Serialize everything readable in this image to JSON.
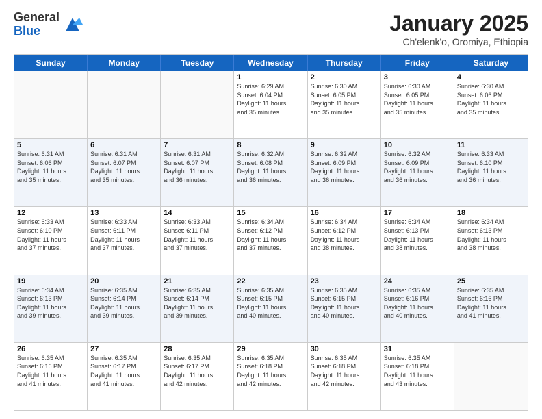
{
  "header": {
    "logo_general": "General",
    "logo_blue": "Blue",
    "month_title": "January 2025",
    "subtitle": "Ch'elenk'o, Oromiya, Ethiopia"
  },
  "day_headers": [
    "Sunday",
    "Monday",
    "Tuesday",
    "Wednesday",
    "Thursday",
    "Friday",
    "Saturday"
  ],
  "weeks": [
    [
      {
        "day": "",
        "info": ""
      },
      {
        "day": "",
        "info": ""
      },
      {
        "day": "",
        "info": ""
      },
      {
        "day": "1",
        "info": "Sunrise: 6:29 AM\nSunset: 6:04 PM\nDaylight: 11 hours\nand 35 minutes."
      },
      {
        "day": "2",
        "info": "Sunrise: 6:30 AM\nSunset: 6:05 PM\nDaylight: 11 hours\nand 35 minutes."
      },
      {
        "day": "3",
        "info": "Sunrise: 6:30 AM\nSunset: 6:05 PM\nDaylight: 11 hours\nand 35 minutes."
      },
      {
        "day": "4",
        "info": "Sunrise: 6:30 AM\nSunset: 6:06 PM\nDaylight: 11 hours\nand 35 minutes."
      }
    ],
    [
      {
        "day": "5",
        "info": "Sunrise: 6:31 AM\nSunset: 6:06 PM\nDaylight: 11 hours\nand 35 minutes."
      },
      {
        "day": "6",
        "info": "Sunrise: 6:31 AM\nSunset: 6:07 PM\nDaylight: 11 hours\nand 35 minutes."
      },
      {
        "day": "7",
        "info": "Sunrise: 6:31 AM\nSunset: 6:07 PM\nDaylight: 11 hours\nand 36 minutes."
      },
      {
        "day": "8",
        "info": "Sunrise: 6:32 AM\nSunset: 6:08 PM\nDaylight: 11 hours\nand 36 minutes."
      },
      {
        "day": "9",
        "info": "Sunrise: 6:32 AM\nSunset: 6:09 PM\nDaylight: 11 hours\nand 36 minutes."
      },
      {
        "day": "10",
        "info": "Sunrise: 6:32 AM\nSunset: 6:09 PM\nDaylight: 11 hours\nand 36 minutes."
      },
      {
        "day": "11",
        "info": "Sunrise: 6:33 AM\nSunset: 6:10 PM\nDaylight: 11 hours\nand 36 minutes."
      }
    ],
    [
      {
        "day": "12",
        "info": "Sunrise: 6:33 AM\nSunset: 6:10 PM\nDaylight: 11 hours\nand 37 minutes."
      },
      {
        "day": "13",
        "info": "Sunrise: 6:33 AM\nSunset: 6:11 PM\nDaylight: 11 hours\nand 37 minutes."
      },
      {
        "day": "14",
        "info": "Sunrise: 6:33 AM\nSunset: 6:11 PM\nDaylight: 11 hours\nand 37 minutes."
      },
      {
        "day": "15",
        "info": "Sunrise: 6:34 AM\nSunset: 6:12 PM\nDaylight: 11 hours\nand 37 minutes."
      },
      {
        "day": "16",
        "info": "Sunrise: 6:34 AM\nSunset: 6:12 PM\nDaylight: 11 hours\nand 38 minutes."
      },
      {
        "day": "17",
        "info": "Sunrise: 6:34 AM\nSunset: 6:13 PM\nDaylight: 11 hours\nand 38 minutes."
      },
      {
        "day": "18",
        "info": "Sunrise: 6:34 AM\nSunset: 6:13 PM\nDaylight: 11 hours\nand 38 minutes."
      }
    ],
    [
      {
        "day": "19",
        "info": "Sunrise: 6:34 AM\nSunset: 6:13 PM\nDaylight: 11 hours\nand 39 minutes."
      },
      {
        "day": "20",
        "info": "Sunrise: 6:35 AM\nSunset: 6:14 PM\nDaylight: 11 hours\nand 39 minutes."
      },
      {
        "day": "21",
        "info": "Sunrise: 6:35 AM\nSunset: 6:14 PM\nDaylight: 11 hours\nand 39 minutes."
      },
      {
        "day": "22",
        "info": "Sunrise: 6:35 AM\nSunset: 6:15 PM\nDaylight: 11 hours\nand 40 minutes."
      },
      {
        "day": "23",
        "info": "Sunrise: 6:35 AM\nSunset: 6:15 PM\nDaylight: 11 hours\nand 40 minutes."
      },
      {
        "day": "24",
        "info": "Sunrise: 6:35 AM\nSunset: 6:16 PM\nDaylight: 11 hours\nand 40 minutes."
      },
      {
        "day": "25",
        "info": "Sunrise: 6:35 AM\nSunset: 6:16 PM\nDaylight: 11 hours\nand 41 minutes."
      }
    ],
    [
      {
        "day": "26",
        "info": "Sunrise: 6:35 AM\nSunset: 6:16 PM\nDaylight: 11 hours\nand 41 minutes."
      },
      {
        "day": "27",
        "info": "Sunrise: 6:35 AM\nSunset: 6:17 PM\nDaylight: 11 hours\nand 41 minutes."
      },
      {
        "day": "28",
        "info": "Sunrise: 6:35 AM\nSunset: 6:17 PM\nDaylight: 11 hours\nand 42 minutes."
      },
      {
        "day": "29",
        "info": "Sunrise: 6:35 AM\nSunset: 6:18 PM\nDaylight: 11 hours\nand 42 minutes."
      },
      {
        "day": "30",
        "info": "Sunrise: 6:35 AM\nSunset: 6:18 PM\nDaylight: 11 hours\nand 42 minutes."
      },
      {
        "day": "31",
        "info": "Sunrise: 6:35 AM\nSunset: 6:18 PM\nDaylight: 11 hours\nand 43 minutes."
      },
      {
        "day": "",
        "info": ""
      }
    ]
  ],
  "alt_rows": [
    1,
    3
  ]
}
